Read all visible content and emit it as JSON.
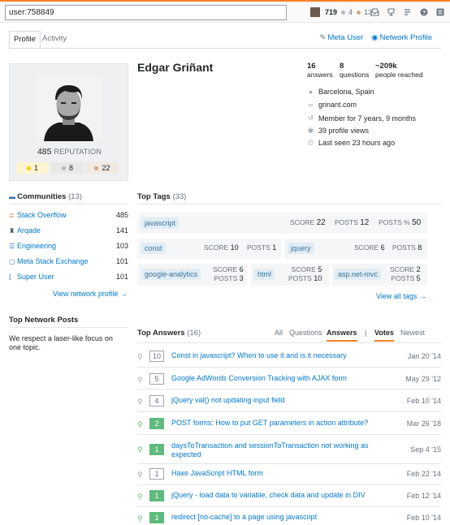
{
  "topbar": {
    "search_value": "user:758849",
    "reputation": "719",
    "silver": "4",
    "bronze": "13"
  },
  "tabs": {
    "profile": "Profile",
    "activity": "Activity"
  },
  "meta_links": {
    "meta_user": "Meta User",
    "network_profile": "Network Profile"
  },
  "user": {
    "name": "Edgar Griñant",
    "reputation": "485",
    "reputation_label": "REPUTATION",
    "badges": {
      "gold": "1",
      "silver": "8",
      "bronze": "22"
    }
  },
  "stats": {
    "answers": {
      "value": "16",
      "label": "answers"
    },
    "questions": {
      "value": "8",
      "label": "questions"
    },
    "reached": {
      "value": "~209k",
      "label": "people reached"
    }
  },
  "info": {
    "location": "Barcelona, Spain",
    "website": "grinant.com",
    "member": "Member for 7 years, 9 months",
    "views": "39 profile views",
    "seen": "Last seen 23 hours ago"
  },
  "communities": {
    "title": "Communities",
    "count": "(13)",
    "items": [
      {
        "name": "Stack Overflow",
        "rep": "485",
        "color": "#f48024"
      },
      {
        "name": "Arqade",
        "rep": "141",
        "color": "#3d4b61"
      },
      {
        "name": "Engineering",
        "rep": "103",
        "color": "#2d7ec4"
      },
      {
        "name": "Meta Stack Exchange",
        "rep": "101",
        "color": "#3b6fa8"
      },
      {
        "name": "Super User",
        "rep": "101",
        "color": "#2a6db5"
      }
    ],
    "view_more": "View network profile →"
  },
  "network_posts": {
    "title": "Top Network Posts",
    "text": "We respect a laser-like focus on one topic."
  },
  "top_tags": {
    "title": "Top Tags",
    "count": "(33)",
    "score_label": "SCORE",
    "posts_label": "POSTS",
    "posts_pct_label": "POSTS %",
    "main": {
      "name": "javascript",
      "score": "22",
      "posts": "12",
      "pct": "50"
    },
    "row2": [
      {
        "name": "const",
        "score": "10",
        "posts": "1"
      },
      {
        "name": "jquery",
        "score": "6",
        "posts": "8"
      }
    ],
    "row3": [
      {
        "name": "google-analytics",
        "score": "6",
        "posts": "3"
      },
      {
        "name": "html",
        "score": "5",
        "posts": "10"
      },
      {
        "name": "asp.net-mvc",
        "score": "2",
        "posts": "5"
      }
    ],
    "view_all": "View all tags →"
  },
  "top_answers": {
    "title": "Top Answers",
    "count": "(16)",
    "filters": {
      "all": "All",
      "questions": "Questions",
      "answers": "Answers",
      "sep": "|",
      "votes": "Votes",
      "newest": "Newest"
    },
    "items": [
      {
        "score": "10",
        "accepted": false,
        "title": "Const in javascript? When to use it and is it necessary",
        "date": "Jan 20 '14"
      },
      {
        "score": "5",
        "accepted": false,
        "title": "Google AdWords Conversion Tracking with AJAX form",
        "date": "May 29 '12"
      },
      {
        "score": "4",
        "accepted": false,
        "title": "jQuery val() not updating input field",
        "date": "Feb 10 '14"
      },
      {
        "score": "2",
        "accepted": true,
        "title": "POST forms: How to put GET parameters in action attribute?",
        "date": "Mar 26 '18"
      },
      {
        "score": "1",
        "accepted": true,
        "title": "daysToTransaction and sessionToTransaction not working as expected",
        "date": "Sep 4 '15"
      },
      {
        "score": "1",
        "accepted": false,
        "title": "Haxe JavaScript HTML form",
        "date": "Feb 22 '14"
      },
      {
        "score": "1",
        "accepted": true,
        "title": "jQuery - load data to variable, check data and update in DIV",
        "date": "Feb 12 '14"
      },
      {
        "score": "1",
        "accepted": true,
        "title": "redirect [no-cache] to a page using javascript",
        "date": "Feb 10 '14"
      }
    ]
  },
  "colors": {
    "accent": "#f48024",
    "link": "#0077cc",
    "accepted": "#5eba7d",
    "tag_bg": "#e1ecf4"
  }
}
